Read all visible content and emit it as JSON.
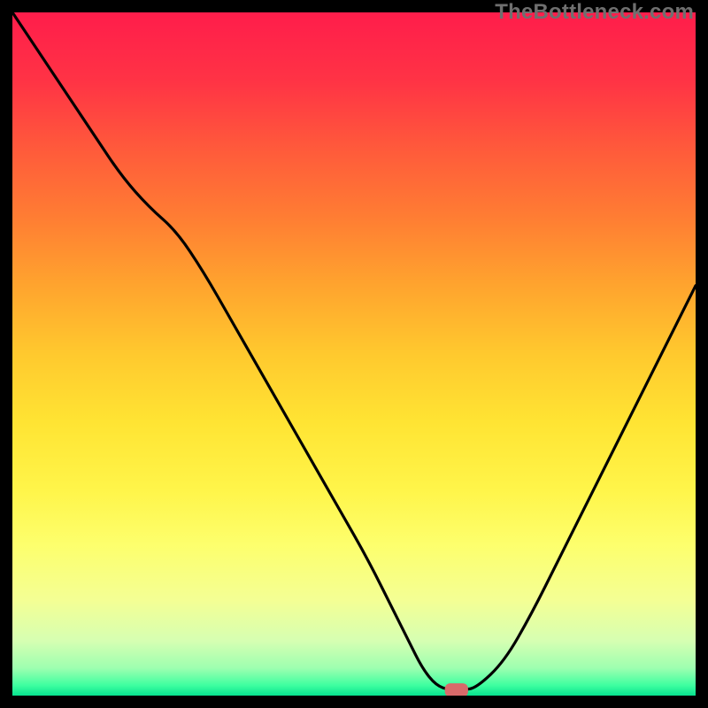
{
  "watermark": "TheBottleneck.com",
  "chart_data": {
    "type": "line",
    "title": "",
    "xlabel": "",
    "ylabel": "",
    "xlim": [
      0,
      100
    ],
    "ylim": [
      0,
      100
    ],
    "background": {
      "type": "vertical-gradient",
      "stops": [
        {
          "pos": 0.0,
          "color": "#ff1d4b"
        },
        {
          "pos": 0.1,
          "color": "#ff3345"
        },
        {
          "pos": 0.2,
          "color": "#ff5a3b"
        },
        {
          "pos": 0.3,
          "color": "#ff7d33"
        },
        {
          "pos": 0.4,
          "color": "#ffa42e"
        },
        {
          "pos": 0.5,
          "color": "#ffc92e"
        },
        {
          "pos": 0.6,
          "color": "#ffe433"
        },
        {
          "pos": 0.7,
          "color": "#fff54a"
        },
        {
          "pos": 0.78,
          "color": "#fdff6d"
        },
        {
          "pos": 0.86,
          "color": "#f4ff94"
        },
        {
          "pos": 0.92,
          "color": "#d6ffb2"
        },
        {
          "pos": 0.96,
          "color": "#9dffb0"
        },
        {
          "pos": 0.985,
          "color": "#3effa0"
        },
        {
          "pos": 1.0,
          "color": "#07e28e"
        }
      ]
    },
    "series": [
      {
        "name": "bottleneck-curve",
        "color": "#000000",
        "width": 3.2,
        "x": [
          0,
          4,
          8,
          12,
          16,
          20,
          24,
          28,
          32,
          36,
          40,
          44,
          48,
          52,
          56,
          58,
          60,
          62,
          64,
          66,
          68,
          72,
          76,
          80,
          84,
          88,
          92,
          96,
          100
        ],
        "y": [
          100,
          94,
          88,
          82,
          76,
          71.5,
          68,
          62,
          55,
          48,
          41,
          34,
          27,
          20,
          12,
          8,
          4,
          1.5,
          0.8,
          0.8,
          1.2,
          5,
          12,
          20,
          28,
          36,
          44,
          52,
          60
        ]
      }
    ],
    "marker": {
      "name": "optimal-point",
      "x": 65,
      "y": 0.8,
      "width_frac": 0.034,
      "height_frac": 0.02,
      "color": "#d86a6a"
    }
  }
}
